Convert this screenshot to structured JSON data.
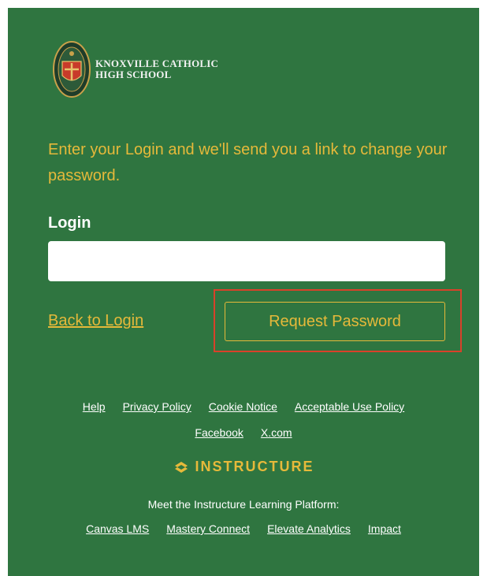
{
  "header": {
    "school_line1": "KNOXVILLE CATHOLIC",
    "school_line2": "HIGH SCHOOL",
    "seal_icon": "school-seal-icon"
  },
  "form": {
    "instructions": "Enter your Login and we'll send you a link to change your password.",
    "login_label": "Login",
    "login_value": "",
    "login_placeholder": "",
    "back_link": "Back to Login",
    "submit_label": "Request Password"
  },
  "footer": {
    "links_row1": [
      "Help",
      "Privacy Policy",
      "Cookie Notice",
      "Acceptable Use Policy"
    ],
    "links_row2": [
      "Facebook",
      "X.com"
    ],
    "brand": "INSTRUCTURE",
    "brand_icon": "instructure-logo-icon",
    "platform_text": "Meet the Instructure Learning Platform:",
    "links_row3": [
      "Canvas LMS",
      "Mastery Connect",
      "Elevate Analytics",
      "Impact"
    ]
  },
  "colors": {
    "background": "#2f7540",
    "accent": "#e6b93a",
    "highlight": "#d9412a"
  }
}
